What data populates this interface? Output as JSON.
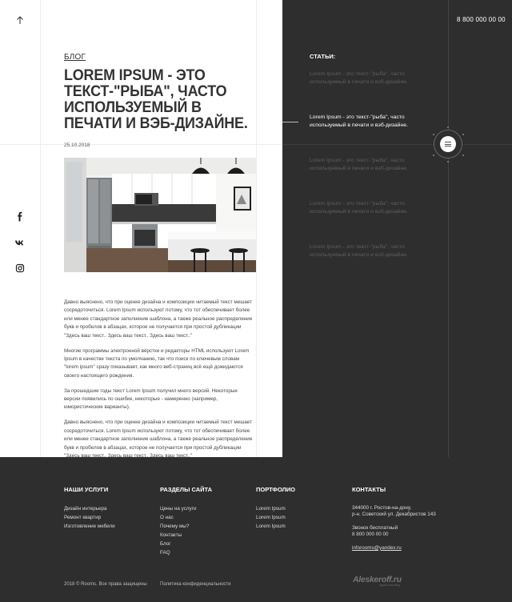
{
  "header": {
    "phone": "8 800 000 00 00"
  },
  "article": {
    "breadcrumb": "Блог",
    "title": "Lorem Ipsum - это текст-\"рыба\", часто используемый в печати и вэб-дизайне.",
    "date": "25.10.2018",
    "paragraphs": [
      "Давно выяснено, что при оценке дизайна и композиции читаемый текст мешает сосредоточиться. Lorem Ipsum используют потому, что тот обеспечивает более или менее стандартное заполнение шаблона, а также реальное распределение букв и пробелов в абзацах, которое не получается при простой дубликации \"Здесь ваш текст.. Здесь ваш текст.. Здесь ваш текст..\"",
      "Многие программы электронной вёрстки и редакторы HTML используют Lorem Ipsum в качестве текста по умолчанию, так что поиск по ключевым словам \"lorem ipsum\" сразу показывает, как много веб-страниц всё ещё дожидаются своего настоящего рождения.",
      "За прошедшие годы текст Lorem Ipsum получил много версий. Некоторые версии появились по ошибке, некоторые - намеренно (например, юмористические варианты).",
      "Давно выяснено, что при оценке дизайна и композиции читаемый текст мешает сосредоточиться. Lorem Ipsum используют потому, что тот обеспечивает более или менее стандартное заполнение шаблона, а также реальное распределение букв и пробелов в абзацах, которое не получается при простой дубликации \"Здесь ваш текст.. Здесь ваш текст.. Здесь ваш текст..\""
    ]
  },
  "sidebar": {
    "heading": "Статьи:",
    "items": [
      "Lorem Ipsum - это текст-\"рыба\", часто используемый в печати и вэб-дизайне.",
      "Lorem Ipsum - это текст-\"рыба\", часто используемый в печати и вэб-дизайне.",
      "Lorem Ipsum - это текст-\"рыба\", часто используемый в печати и вэб-дизайне.",
      "Lorem Ipsum - это текст-\"рыба\", часто используемый в печати и вэб-дизайне.",
      "Lorem Ipsum - это текст-\"рыба\", часто используемый в печати и вэб-дизайне."
    ],
    "active_index": 1
  },
  "social": [
    "facebook-icon",
    "vk-icon",
    "instagram-icon"
  ],
  "footer": {
    "services": {
      "heading": "Наши услуги",
      "links": [
        "Дизайн интерьера",
        "Ремонт квартир",
        "Изготовление мебели"
      ]
    },
    "sections": {
      "heading": "Разделы сайта",
      "links": [
        "Цены на услуги",
        "О нас",
        "Почему мы?",
        "Контакты",
        "Блог",
        "FAQ"
      ]
    },
    "portfolio": {
      "heading": "Портфолио",
      "links": [
        "Lorem Ipsum",
        "Lorem Ipsum",
        "Lorem Ipsum"
      ]
    },
    "contacts": {
      "heading": "Контакты",
      "address_line1": "344000 г. Ростов-на-дону,",
      "address_line2": "р-н. Советский ул. Декабристов 143",
      "call_label": "Звонок бесплатный",
      "phone": "8 800 000 00 00",
      "email": "inforooms@yandex.ru"
    },
    "copyright": "2018 © Rooms. Все права защищены",
    "privacy": "Политика конфиденциальности",
    "developer": "Aleskeroff.ru",
    "developer_sub": "digital branding"
  },
  "colors": {
    "dark_bg": "#2e2e2e",
    "light_bg": "#ffffff",
    "muted_text": "#5e5e5e"
  }
}
